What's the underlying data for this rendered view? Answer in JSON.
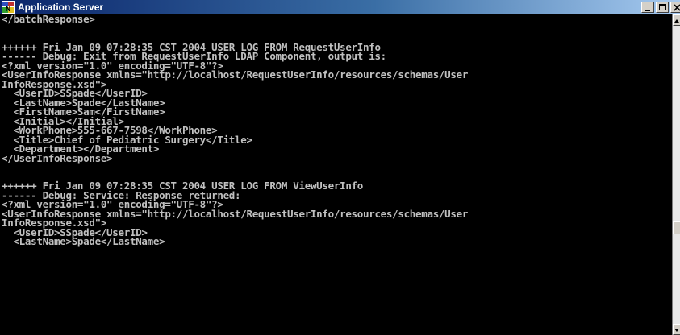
{
  "window": {
    "title": "Application Server",
    "icon": "app-server-icon",
    "controls": [
      "minimize-icon",
      "maximize-icon",
      "close-icon"
    ]
  },
  "console": {
    "lines": [
      "</batchResponse>",
      "",
      "",
      "++++++ Fri Jan 09 07:28:35 CST 2004 USER LOG FROM RequestUserInfo",
      "------ Debug: Exit from RequestUserInfo LDAP Component, output is:",
      "<?xml version=\"1.0\" encoding=\"UTF-8\"?>",
      "<UserInfoResponse xmlns=\"http://localhost/RequestUserInfo/resources/schemas/User",
      "InfoResponse.xsd\">",
      "  <UserID>SSpade</UserID>",
      "  <LastName>Spade</LastName>",
      "  <FirstName>Sam</FirstName>",
      "  <Initial></Initial>",
      "  <WorkPhone>555-667-7598</WorkPhone>",
      "  <Title>Chief of Pediatric Surgery</Title>",
      "  <Department></Department>",
      "</UserInfoResponse>",
      "",
      "",
      "++++++ Fri Jan 09 07:28:35 CST 2004 USER LOG FROM ViewUserInfo",
      "------ Debug: Service: Response returned:",
      "<?xml version=\"1.0\" encoding=\"UTF-8\"?>",
      "<UserInfoResponse xmlns=\"http://localhost/RequestUserInfo/resources/schemas/User",
      "InfoResponse.xsd\">",
      "  <UserID>SSpade</UserID>",
      "  <LastName>Spade</LastName>"
    ]
  },
  "colors": {
    "titlebar_start": "#0a246a",
    "titlebar_end": "#a6caf0",
    "console_bg": "#000000",
    "console_text": "#c0c0c0"
  }
}
